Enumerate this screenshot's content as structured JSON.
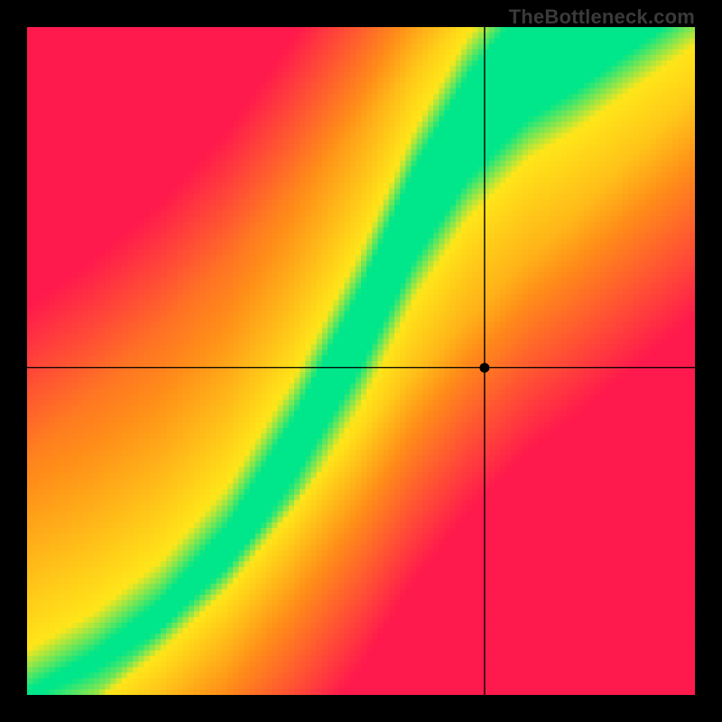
{
  "watermark": "TheBottleneck.com",
  "chart_data": {
    "type": "heatmap",
    "title": "",
    "xlabel": "",
    "ylabel": "",
    "xlim": [
      0,
      1
    ],
    "ylim": [
      0,
      1
    ],
    "resolution": 120,
    "crosshair": {
      "x": 0.685,
      "y": 0.49
    },
    "colors": {
      "red": "#ff1a4d",
      "orange": "#ff8c1a",
      "yellow": "#ffe619",
      "green": "#00e68a"
    },
    "ridge": {
      "control_points": [
        {
          "x": 0.0,
          "y": 0.0
        },
        {
          "x": 0.1,
          "y": 0.05
        },
        {
          "x": 0.2,
          "y": 0.12
        },
        {
          "x": 0.3,
          "y": 0.22
        },
        {
          "x": 0.4,
          "y": 0.37
        },
        {
          "x": 0.5,
          "y": 0.55
        },
        {
          "x": 0.58,
          "y": 0.72
        },
        {
          "x": 0.66,
          "y": 0.85
        },
        {
          "x": 0.75,
          "y": 0.95
        },
        {
          "x": 0.82,
          "y": 1.0
        }
      ],
      "width_profile": [
        {
          "x": 0.0,
          "w": 0.006
        },
        {
          "x": 0.2,
          "w": 0.02
        },
        {
          "x": 0.4,
          "w": 0.045
        },
        {
          "x": 0.6,
          "w": 0.07
        },
        {
          "x": 0.82,
          "w": 0.095
        }
      ]
    },
    "background_gradients": {
      "upper_left": "red",
      "lower_right": "red",
      "near_ridge": "green",
      "mid": "yellow",
      "far_warm": "orange"
    }
  },
  "series": []
}
